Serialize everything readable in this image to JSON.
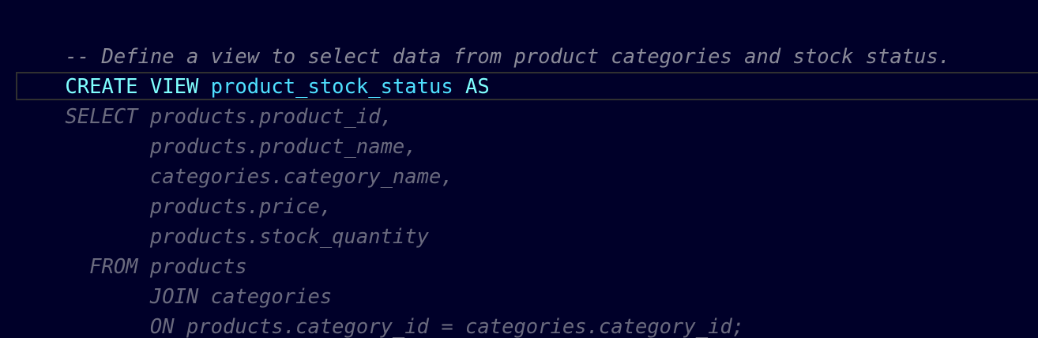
{
  "editor": {
    "colors": {
      "background": "#000029",
      "comment": "#8a8a98",
      "keyword": "#7fffff",
      "identifier": "#4fe0ff",
      "dimmed": "#6a6a7e",
      "current_line_border": "#303030"
    },
    "lines": [
      {
        "text": "-- Define a view to select data from product categories and stock status."
      },
      {
        "kw1": "CREATE VIEW ",
        "ident": "product_stock_status",
        "kw2": " AS"
      },
      {
        "text": "SELECT products.product_id,"
      },
      {
        "text": "       products.product_name,"
      },
      {
        "text": "       categories.category_name,"
      },
      {
        "text": "       products.price,"
      },
      {
        "text": "       products.stock_quantity"
      },
      {
        "text": "  FROM products"
      },
      {
        "text": "       JOIN categories"
      },
      {
        "text": "       ON products.category_id = categories.category_id;"
      }
    ]
  }
}
